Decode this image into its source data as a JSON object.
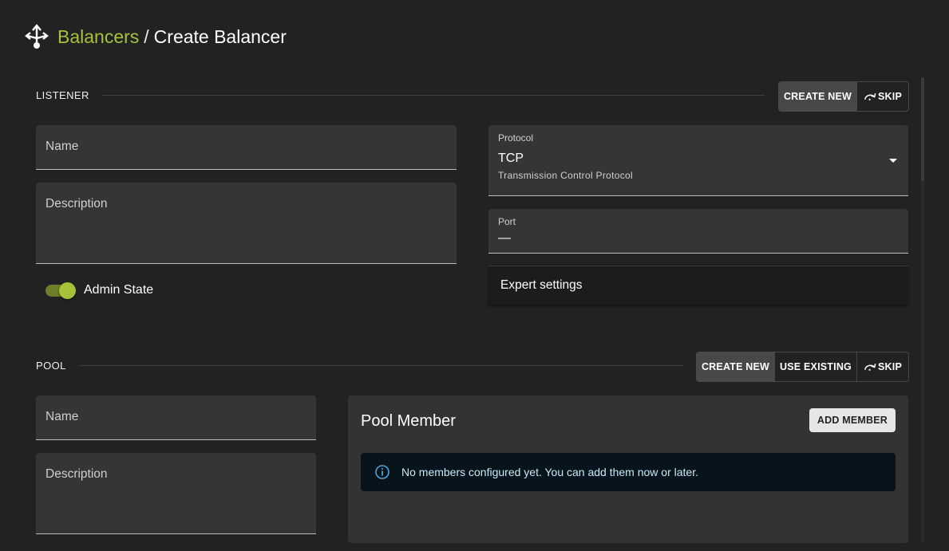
{
  "header": {
    "icon": "load-balancer-icon",
    "breadcrumb_link": "Balancers",
    "separator": "/",
    "title": "Create Balancer",
    "accent_color": "#a6c13a"
  },
  "listener": {
    "section_title": "LISTENER",
    "actions": {
      "create_new": "CREATE NEW",
      "skip": "SKIP",
      "active": "create_new"
    },
    "name_placeholder": "Name",
    "description_placeholder": "Description",
    "admin_state": {
      "label": "Admin State",
      "enabled": true
    },
    "protocol": {
      "label": "Protocol",
      "value": "TCP",
      "description": "Transmission Control Protocol"
    },
    "port": {
      "label": "Port",
      "value": "—"
    },
    "expert_settings": "Expert settings"
  },
  "pool": {
    "section_title": "POOL",
    "actions": {
      "create_new": "CREATE NEW",
      "use_existing": "USE EXISTING",
      "skip": "SKIP",
      "active": "create_new"
    },
    "name_placeholder": "Name",
    "description_placeholder": "Description",
    "pool_member": {
      "title": "Pool Member",
      "add_button": "ADD MEMBER",
      "empty_message": "No members configured yet. You can add them now or later.",
      "info_color": "#4aa8e0"
    }
  }
}
